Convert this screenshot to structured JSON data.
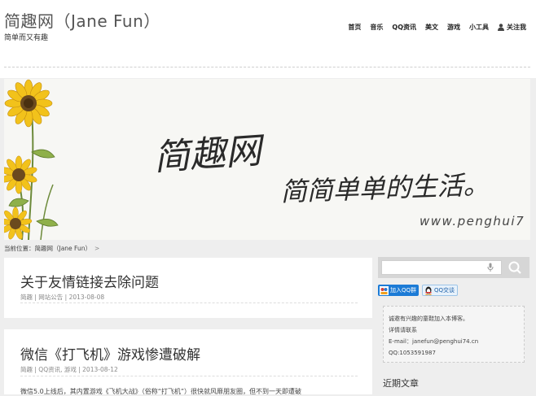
{
  "header": {
    "title": "简趣网（Jane Fun）",
    "subtitle": "简单而又有趣"
  },
  "nav": {
    "items": [
      "首页",
      "音乐",
      "QQ资讯",
      "美文",
      "游戏",
      "小工具"
    ],
    "follow_label": "关注我"
  },
  "banner": {
    "title": "简趣网",
    "slogan": "简简单单的生活。",
    "url": "www.penghui7"
  },
  "breadcrumb": {
    "prefix": "当前位置：",
    "current": "简趣网（Jane Fun）",
    "separator": ">"
  },
  "posts": [
    {
      "title": "关于友情链接去除问题",
      "meta": "简趣 | 网站公告 | 2013-08-08"
    },
    {
      "title": "微信《打飞机》游戏惨遭破解",
      "meta": "简趣 | QQ资讯, 游戏 | 2013-08-12",
      "excerpt": "微信5.0上线后，其内置游戏《飞机大战》（俗称“打飞机”）很快就风靡朋友圈，但不到一天即遭破"
    }
  ],
  "sidebar": {
    "search_placeholder": "",
    "qq_group_label": "加入QQ群",
    "qq_talk_label": "QQ交谈",
    "info_lines": [
      "诚邀有兴趣的童鞋加入本博客。",
      "详情请联系",
      "E-mail：janefun@penghui74.cn",
      "QQ:1053591987"
    ],
    "recent_title": "近期文章"
  },
  "colors": {
    "background": "#eeeeee",
    "qq_blue": "#1c7bd6",
    "sunflower_yellow": "#f2c21b"
  },
  "icons": [
    "user-icon",
    "mic-icon",
    "search-icon",
    "qq-group-icon",
    "qq-penguin-icon"
  ]
}
